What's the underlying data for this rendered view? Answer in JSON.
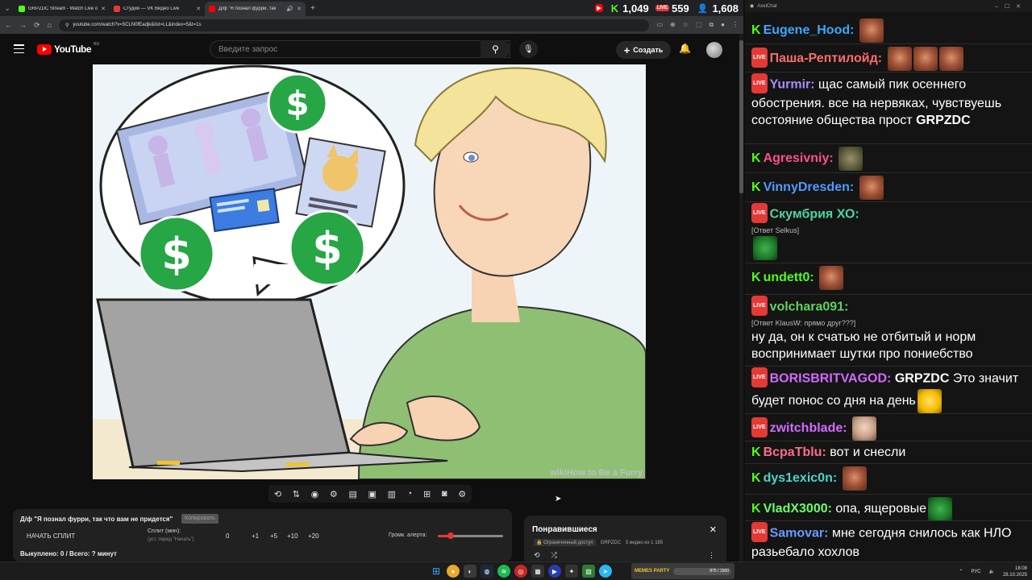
{
  "browser": {
    "tabs": [
      {
        "title": "GRPZDC Stream - Watch Live o",
        "color": "#53fc18",
        "active": false
      },
      {
        "title": "Студия — VK Видео Live",
        "color": "#e53935",
        "active": false
      },
      {
        "title": "Д/ф \"Я познал фурри, так",
        "color": "#ff0000",
        "active": true
      }
    ],
    "url": "youtube.com/watch?v=5CLN0fEadjk&list=LL&index=5&t=1s",
    "new_tab": "+"
  },
  "stream_stats": [
    {
      "platform": "youtube",
      "icon": "▶",
      "value": "",
      "color": "#ff0000"
    },
    {
      "platform": "kick",
      "icon": "K",
      "value": "1,049",
      "color": "#53fc18"
    },
    {
      "platform": "vk",
      "icon": "LIVE",
      "value": "559",
      "color": "#e53935"
    },
    {
      "platform": "viewers",
      "icon": "👤",
      "value": "1,608",
      "color": "#3ea6ff"
    }
  ],
  "youtube": {
    "logo_text": "YouTube",
    "region": "RU",
    "search_placeholder": "Введите запрос",
    "create_label": "Создать",
    "watermark": "wikiHow to Be a Furry"
  },
  "split_panel": {
    "title": "Д/ф \"Я познал фурри, так что вам не придется\"",
    "copy_label": "Копировать",
    "start_label": "НАЧАТЬ СПЛИТ",
    "split_label": "Сплит (мин):",
    "split_hint": "(уст. перед \"Начать\")",
    "split_value": "0",
    "steps": [
      "+1",
      "+5",
      "+10",
      "+20"
    ],
    "alert_volume_label": "Громк. алерта:",
    "alert_volume": 0.2,
    "spent_text": "Выкуплено: 0 / Всего: ? минут"
  },
  "liked_panel": {
    "title": "Понравившиеся",
    "access": "Ограниченный доступ",
    "channel": "GRPZDC",
    "meta": "5 видео из 1 185"
  },
  "chat": {
    "window_title": "AxelChat",
    "messages": [
      {
        "platform": "kick",
        "user": "Eugene_Hood:",
        "color": "#3ea6ff",
        "text": "",
        "emotes": [
          "face"
        ]
      },
      {
        "platform": "vk",
        "user": "Паша-Рептилойд:",
        "color": "#ff6b6b",
        "text": "",
        "emotes": [
          "face",
          "face",
          "face"
        ]
      },
      {
        "platform": "vk",
        "user": "Yurmir:",
        "color": "#a98bff",
        "text": "щас самый пик осеннего обострения. все на нервяках, чувствуешь состояние общества прост",
        "bold_tail": "GRPZDC"
      },
      {
        "platform": "kick",
        "user": "Agresivniy:",
        "color": "#ff4f8b",
        "text": "",
        "emotes": [
          "croc"
        ]
      },
      {
        "platform": "kick",
        "user": "VinnyDresden:",
        "color": "#4f9bff",
        "text": "",
        "emotes": [
          "face"
        ]
      },
      {
        "platform": "vk",
        "user": "Скумбрия ХО:",
        "color": "#4fd3a0",
        "reply": "[Ответ Selkus]",
        "text": "",
        "emotes": [
          "pepe"
        ]
      },
      {
        "platform": "kick",
        "user": "undett0:",
        "color": "#53fc18",
        "text": "",
        "emotes": [
          "face"
        ]
      },
      {
        "platform": "vk",
        "user": "volchara091:",
        "color": "#5fd35f",
        "reply": "[Ответ KlausW: прямо друг???]",
        "text": "ну да, он к счатью не отбитый и норм воспринимает шутки про пониебство"
      },
      {
        "platform": "vk",
        "user": "BORISBRITVAGOD:",
        "color": "#d36bff",
        "bold_head": "GRPZDC",
        "text": "Это значит будет понос со дня на день",
        "emotes": [
          "yellow"
        ]
      },
      {
        "platform": "vk",
        "user": "zwitchblade:",
        "color": "#d36bff",
        "text": "",
        "emotes": [
          "bald"
        ]
      },
      {
        "platform": "kick",
        "user": "BcpaTblu:",
        "color": "#ff6b8b",
        "text": "вот и снесли"
      },
      {
        "platform": "kick",
        "user": "dys1exic0n:",
        "color": "#4fd3c4",
        "text": "",
        "emotes": [
          "face"
        ]
      },
      {
        "platform": "kick",
        "user": "VladX3000:",
        "color": "#6bff6b",
        "text": "опа, ящеровые",
        "emotes": [
          "pepe"
        ]
      },
      {
        "platform": "vk",
        "user": "Samovar:",
        "color": "#6b9bff",
        "text": "мне сегодня снилось как НЛО разьебало хохлов"
      }
    ]
  },
  "taskbar": {
    "widget_label": "MEMES PARTY",
    "widget_value": "875 / 1500",
    "lang": "РУС",
    "time": "18:08",
    "date": "28.10.2025"
  }
}
